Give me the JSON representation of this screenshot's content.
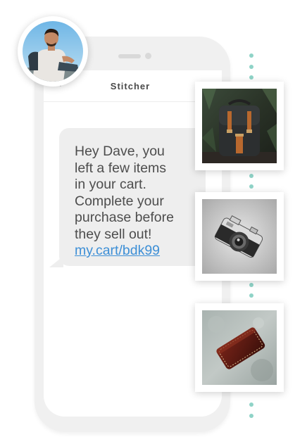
{
  "conversation": {
    "contact_name": "Stitcher",
    "back_icon": "chevron-left-icon"
  },
  "message": {
    "lines": [
      "Hey Dave, you",
      "left a few items",
      "in your cart.",
      "Complete your",
      "purchase before",
      "they sell out!"
    ],
    "link_text": "my.cart/bdk99"
  },
  "avatar": {
    "icon": "user-photo"
  },
  "products": [
    {
      "icon": "backpack-photo"
    },
    {
      "icon": "camera-photo"
    },
    {
      "icon": "wallet-photo"
    }
  ],
  "colors": {
    "accent_dots": "#8fd3c7",
    "link": "#3d8fd6",
    "bubble": "#eeeeee",
    "phone_frame": "#f0f0f0"
  }
}
